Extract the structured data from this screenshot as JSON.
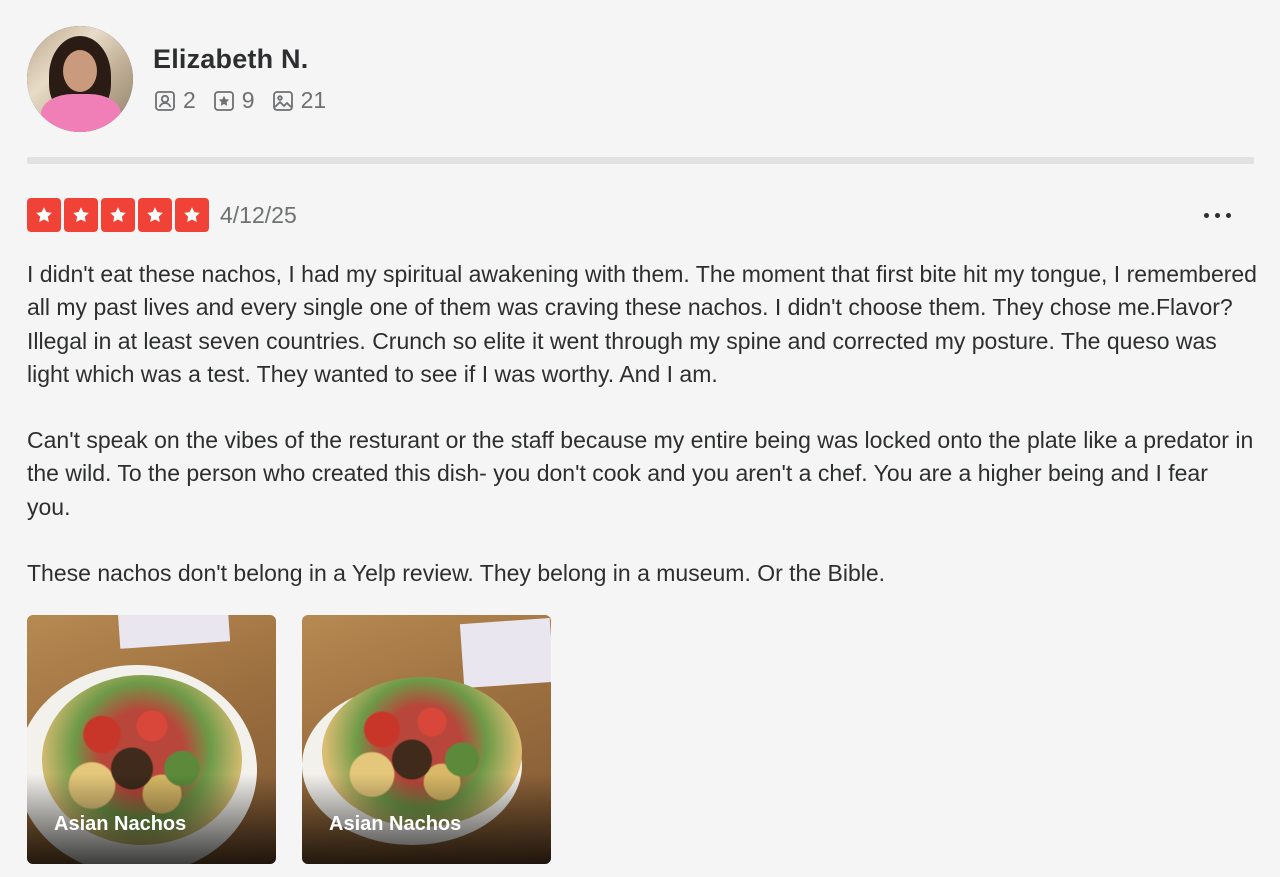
{
  "user": {
    "name": "Elizabeth N.",
    "avatar_icon": "user-avatar-photo",
    "stats": [
      {
        "icon": "friends-icon",
        "value": "2"
      },
      {
        "icon": "reviews-star-icon",
        "value": "9"
      },
      {
        "icon": "photos-icon",
        "value": "21"
      }
    ]
  },
  "review": {
    "rating": 5,
    "max_rating": 5,
    "star_color": "#f04236",
    "date": "4/12/25",
    "paragraphs": [
      "I didn't eat these nachos, I had my spiritual awakening with them. The moment that first bite hit my tongue, I remembered all my past lives and every single one of them was craving these nachos. I didn't choose them. They chose me.Flavor? Illegal in at least seven countries. Crunch so elite it went through my spine and corrected my posture. The queso was light which was a test. They wanted to see if I was worthy. And I am.",
      "Can't speak on the vibes of the resturant or the staff because my entire being was locked onto the plate like a predator in the wild. To the person who created this dish- you don't cook and you aren't a chef. You are a higher being and I fear you.",
      "These nachos don't belong in a Yelp review. They belong in a museum. Or the Bible."
    ],
    "photos": [
      {
        "caption": "Asian Nachos"
      },
      {
        "caption": "Asian Nachos"
      }
    ]
  }
}
